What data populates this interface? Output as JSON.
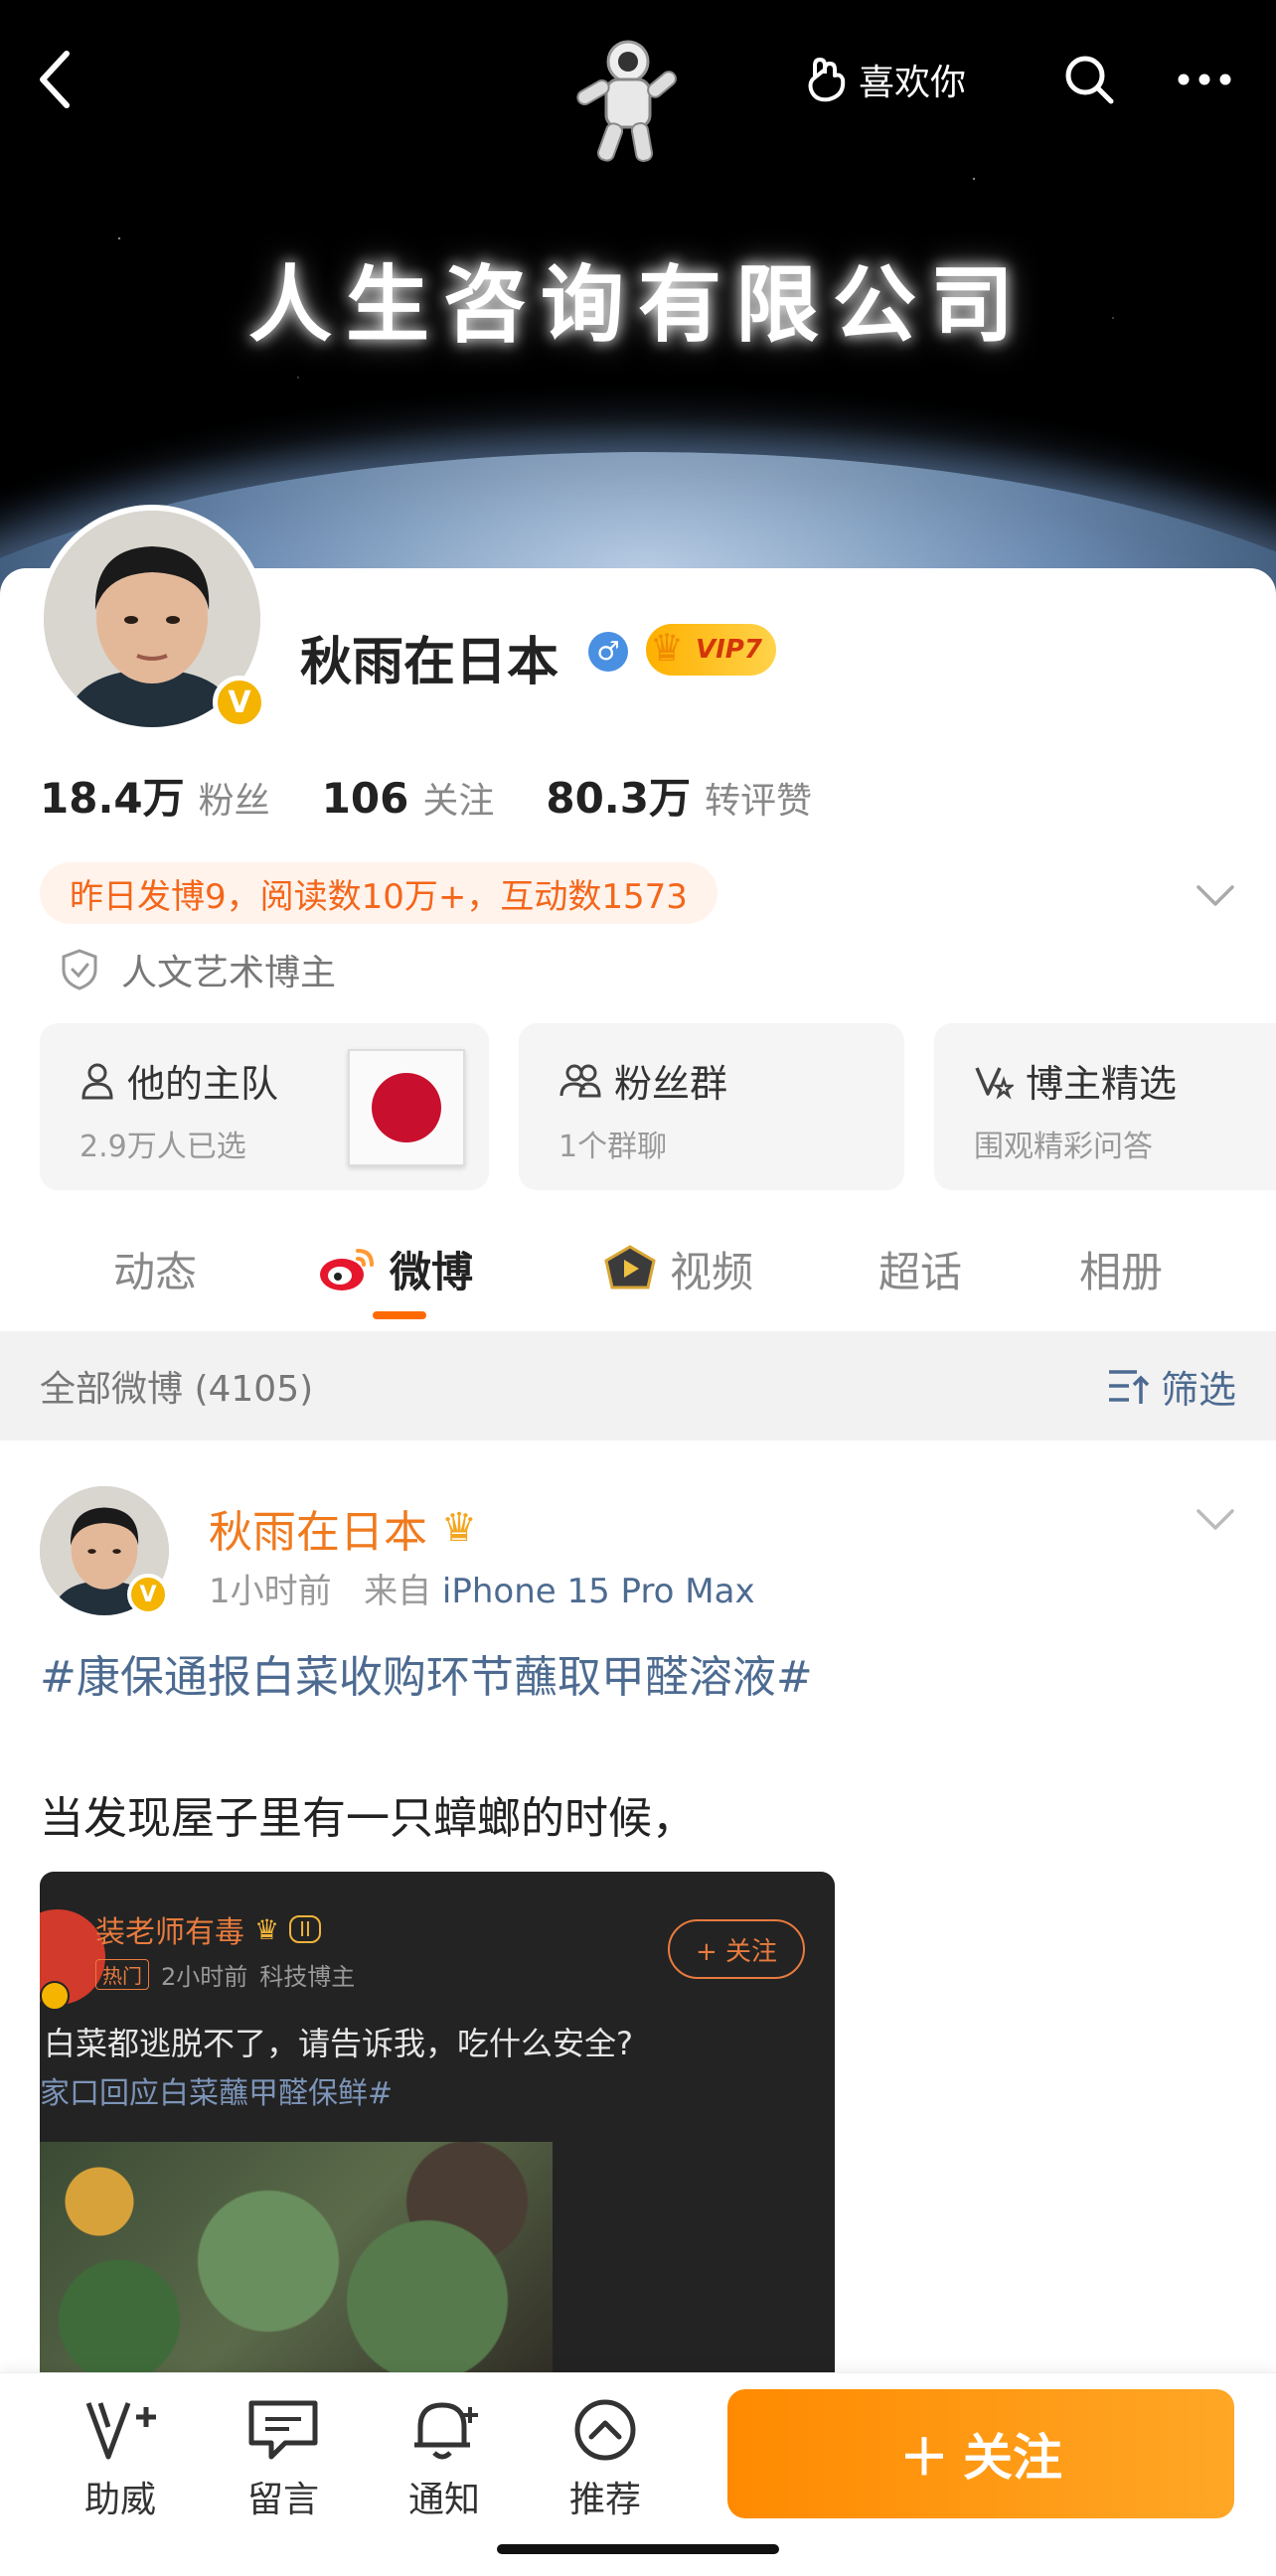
{
  "header": {
    "like_label": "喜欢你",
    "banner_title": "人生咨询有限公司"
  },
  "profile": {
    "name": "秋雨在日本",
    "vip_label": "VIP7",
    "stats": [
      {
        "num": "18.4万",
        "label": "粉丝"
      },
      {
        "num": "106",
        "label": "关注"
      },
      {
        "num": "80.3万",
        "label": "转评赞"
      }
    ],
    "activity": "昨日发博9，阅读数10万+，互动数1573",
    "category": "人文艺术博主",
    "cards": [
      {
        "title": "他的主队",
        "sub": "2.9万人已选"
      },
      {
        "title": "粉丝群",
        "sub": "1个群聊"
      },
      {
        "title": "博主精选",
        "sub": "围观精彩问答"
      }
    ]
  },
  "tabs": [
    {
      "label": "动态"
    },
    {
      "label": "微博"
    },
    {
      "label": "视频"
    },
    {
      "label": "超话"
    },
    {
      "label": "相册"
    }
  ],
  "filter": {
    "count_label": "全部微博 (4105)",
    "filter_label": "筛选"
  },
  "post": {
    "author": "秋雨在日本",
    "time": "1小时前",
    "from": "来自",
    "device": "iPhone 15 Pro Max",
    "hashtag": "#康保通报白菜收购环节蘸取甲醛溶液#",
    "text": "当发现屋子里有一只蟑螂的时候，",
    "embed": {
      "author": "装老师有毒",
      "level": "II",
      "hot": "热门",
      "time": "2小时前",
      "category": "科技博主",
      "follow": "+ 关注",
      "text": "白菜都逃脱不了，请告诉我，吃什么安全?",
      "tag": "家口回应白菜蘸甲醛保鲜#"
    }
  },
  "bottom_bar": {
    "items": [
      {
        "label": "助威"
      },
      {
        "label": "留言"
      },
      {
        "label": "通知"
      },
      {
        "label": "推荐"
      }
    ],
    "follow": "关注"
  },
  "colors": {
    "accent": "#ff6a00",
    "link": "#4d6b91",
    "author": "#f07a1e"
  }
}
